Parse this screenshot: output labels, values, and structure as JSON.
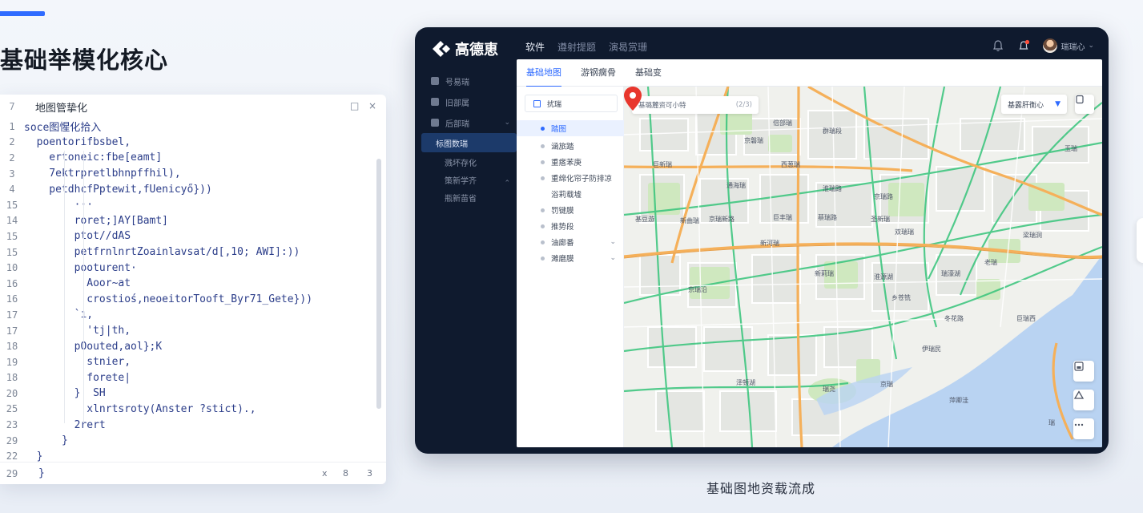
{
  "slide": {
    "title": "基础举模化核心",
    "caption": "基础图地资载流成"
  },
  "code": {
    "header": {
      "line": "7",
      "title": "地图管挚化",
      "btn_window": "□",
      "btn_close": "×"
    },
    "lines": [
      {
        "n": "1",
        "text": "soce图惺化拾入"
      },
      {
        "n": "2",
        "text": "  poentorifbsbel,"
      },
      {
        "n": "2",
        "text": "    ertoneic:fbe[eamt]"
      },
      {
        "n": "3",
        "text": "    7ektrpretlbhnpffhil),"
      },
      {
        "n": "4",
        "text": "    petdhcfPptewit,fUenicyő}))"
      },
      {
        "n": "15",
        "text": "        ···"
      },
      {
        "n": "14",
        "text": "        roret;]AY[Bamt]"
      },
      {
        "n": "15",
        "text": "        ptot//dAS"
      },
      {
        "n": "15",
        "text": "        petfrnlnrtZoainlavsat/d[,10; AWI]:))"
      },
      {
        "n": "10",
        "text": "        pooturent·"
      },
      {
        "n": "16",
        "text": "          Aoor~at"
      },
      {
        "n": "16",
        "text": "          crostioś,neoeitorTooft_Byr71_Gete}))"
      },
      {
        "n": "17",
        "text": "        `ı,"
      },
      {
        "n": "17",
        "text": "          'tj|th,"
      },
      {
        "n": "18",
        "text": "        pOouted,aol};K"
      },
      {
        "n": "19",
        "text": "          stnier,"
      },
      {
        "n": "18",
        "text": "          forete|"
      },
      {
        "n": "20",
        "text": "        }  SH"
      },
      {
        "n": "25",
        "text": "          xlnrtsroty(Anster ?stict).,"
      },
      {
        "n": "23",
        "text": "        2rert"
      },
      {
        "n": "29",
        "text": "      }"
      },
      {
        "n": "22",
        "text": "  }"
      }
    ],
    "footer": {
      "line": "29",
      "brace": "}",
      "btn1": "x",
      "btn2": "8",
      "btn3": "3"
    }
  },
  "app": {
    "logo_text": "高德恵",
    "topnav": [
      "软件",
      "遵射提题",
      "演曷赏珊"
    ],
    "user_name": "瑞瑞心",
    "sidebar": [
      {
        "label": "号易瑞",
        "type": "main"
      },
      {
        "label": "旧部属",
        "type": "main"
      },
      {
        "label": "后部瑞",
        "type": "main",
        "chevron": "⌄"
      },
      {
        "label": "标图数瑞",
        "type": "sub",
        "active": true
      },
      {
        "label": "溅坏存化",
        "type": "sub"
      },
      {
        "label": "策新学齐",
        "type": "sub",
        "chevron": "⌃"
      },
      {
        "label": "瓶新苗省",
        "type": "sub"
      }
    ],
    "tabs": [
      "基础地图",
      "游钢瘸骨",
      "基础变"
    ],
    "layers_head": "扰瑞",
    "layers": [
      {
        "label": "踏图",
        "style": "active"
      },
      {
        "label": "涵旅踏",
        "style": "dot"
      },
      {
        "label": "重瘩苯庚",
        "style": "dot"
      },
      {
        "label": "重绵化帘子防排凉",
        "style": "dot"
      },
      {
        "label": "浴莉载墟",
        "style": "plain"
      },
      {
        "label": "罚键膜",
        "style": "dot"
      },
      {
        "label": "推势段",
        "style": "dot"
      },
      {
        "label": "油廊番",
        "style": "dot",
        "chevron": "⌄"
      },
      {
        "label": "濉磨膜",
        "style": "dot",
        "chevron": "⌄"
      }
    ],
    "map": {
      "search_text": "基璐麓资可小特",
      "search_hint": "(2/3)",
      "select_value": "基露肝衡心",
      "labels": [
        {
          "text": "倍部瑞"
        },
        {
          "text": "群瑞段"
        },
        {
          "text": "京磐瑞"
        },
        {
          "text": "巨新瑞"
        },
        {
          "text": "西葱瑞"
        },
        {
          "text": "通海瑞"
        },
        {
          "text": "淮瑞路"
        },
        {
          "text": "基豆游"
        },
        {
          "text": "新曲瑞"
        },
        {
          "text": "京瑞新路"
        },
        {
          "text": "巨丰瑞"
        },
        {
          "text": "圣新瑞"
        },
        {
          "text": "蔡瑞路"
        },
        {
          "text": "双瑞瑞"
        },
        {
          "text": "梁瑞洞"
        },
        {
          "text": "新河瑞"
        },
        {
          "text": "新莉瑞"
        },
        {
          "text": "淮源湖"
        },
        {
          "text": "瑞濠湖"
        },
        {
          "text": "京瑞沿"
        },
        {
          "text": "乡苍铣"
        },
        {
          "text": "冬花路"
        },
        {
          "text": "巨瑞西"
        },
        {
          "text": "伊瑞民"
        },
        {
          "text": "泽顿湖"
        },
        {
          "text": "瑞尧"
        },
        {
          "text": "京瑞"
        },
        {
          "text": "萍卿洼"
        },
        {
          "text": "瑞"
        },
        {
          "text": "玉瑞"
        },
        {
          "text": "京瑞路"
        },
        {
          "text": "老瑞"
        }
      ]
    }
  },
  "colors": {
    "accent": "#2f6bff",
    "app_bg": "#0f1a2e",
    "water": "#b9d3f2",
    "green": "#cfe8bf",
    "road_major": "#f5b05a",
    "road_main": "#36c47a",
    "pin": "#e8362d"
  }
}
